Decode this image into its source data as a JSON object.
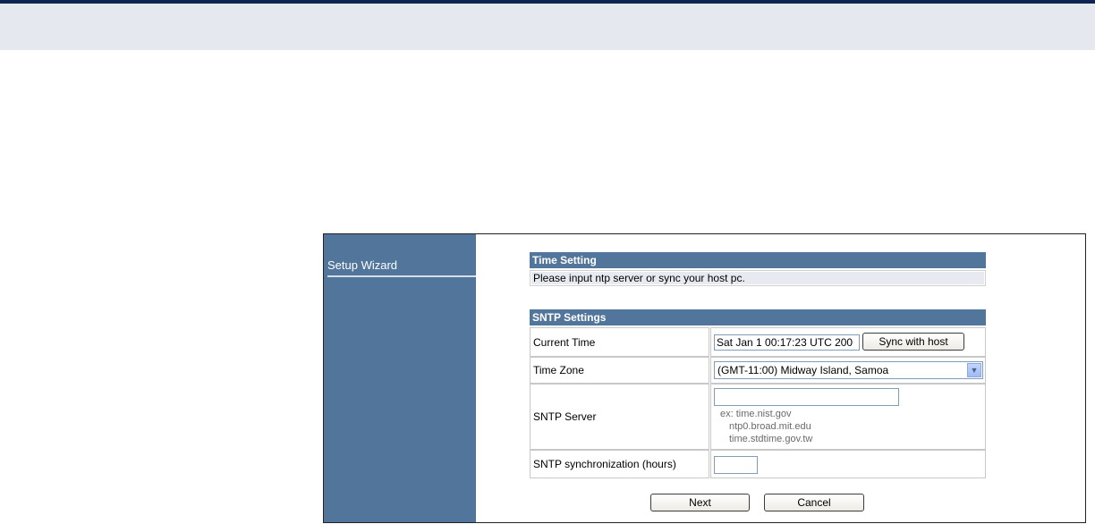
{
  "sidebar": {
    "items": [
      {
        "label": "Setup Wizard"
      }
    ]
  },
  "time_setting": {
    "header": "Time Setting",
    "hint": "Please input ntp server or sync your host pc."
  },
  "sntp": {
    "header": "SNTP Settings",
    "current_time_label": "Current Time",
    "current_time_value": "Sat Jan  1 00:17:23 UTC 200",
    "sync_button": "Sync with host",
    "timezone_label": "Time Zone",
    "timezone_value": "(GMT-11:00) Midway Island, Samoa",
    "server_label": "SNTP Server",
    "server_value": "",
    "examples": [
      "ex: time.nist.gov",
      "ntp0.broad.mit.edu",
      "time.stdtime.gov.tw"
    ],
    "sync_hours_label": "SNTP synchronization (hours)",
    "sync_hours_value": ""
  },
  "actions": {
    "next": "Next",
    "cancel": "Cancel"
  }
}
